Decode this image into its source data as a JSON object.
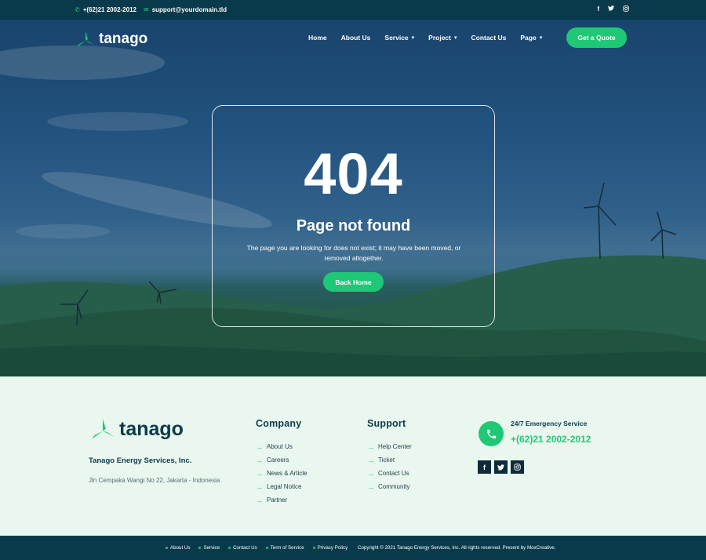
{
  "topbar": {
    "phone": "+(62)21 2002-2012",
    "email": "support@yourdomain.tld",
    "social_icons": [
      "facebook-icon",
      "twitter-icon",
      "instagram-icon"
    ]
  },
  "brand": {
    "name": "tanago",
    "accent_color": "#1ec875",
    "dark_color": "#083a4b"
  },
  "nav": {
    "items": [
      {
        "label": "Home",
        "dropdown": false
      },
      {
        "label": "About Us",
        "dropdown": false
      },
      {
        "label": "Service",
        "dropdown": true
      },
      {
        "label": "Project",
        "dropdown": true
      },
      {
        "label": "Contact Us",
        "dropdown": false
      },
      {
        "label": "Page",
        "dropdown": true
      }
    ],
    "cta_label": "Get a Quote"
  },
  "error": {
    "code": "404",
    "title": "Page not found",
    "message": "The page you are looking for does not exist; it may have been moved, or removed altogether.",
    "button_label": "Back Home"
  },
  "footer": {
    "company_name": "Tanago Energy Services, Inc.",
    "address": "Jln Cempaka Wangi No 22, Jakarta - Indonesia",
    "company_col": {
      "heading": "Company",
      "links": [
        "About Us",
        "Careers",
        "News & Article",
        "Legal Notice",
        "Partner"
      ]
    },
    "support_col": {
      "heading": "Support",
      "links": [
        "Help Center",
        "Ticket",
        "Contact Us",
        "Community"
      ]
    },
    "emergency": {
      "label": "24/7 Emergency Service",
      "phone": "+(62)21 2002-2012"
    },
    "social_icons": [
      "facebook-icon",
      "twitter-icon",
      "instagram-icon"
    ]
  },
  "bottombar": {
    "links": [
      "About Us",
      "Service",
      "Contact Us",
      "Term of Service",
      "Privacy Policy"
    ],
    "copyright": "Copyright © 2021 Tanago Energy Services, Inc. All rights reserved. Present by MoxCreative."
  }
}
